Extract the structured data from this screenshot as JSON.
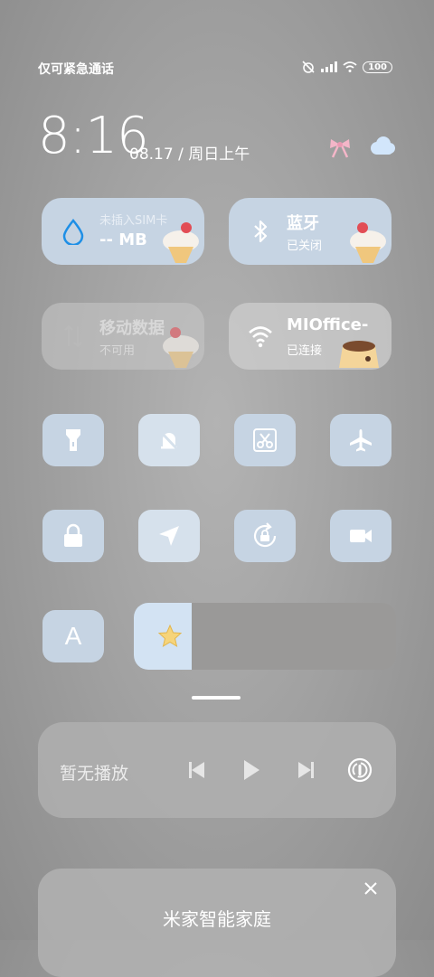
{
  "status_bar": {
    "carrier": "仅可紧急通话",
    "battery": "100"
  },
  "clock": {
    "time": "8:16",
    "date": "08.17 / 周日上午"
  },
  "tiles": [
    {
      "name": "未插入SIM卡",
      "sub": "-- MB",
      "state": "inactive"
    },
    {
      "name": "蓝牙",
      "sub": "已关闭",
      "state": "inactive"
    },
    {
      "name": "移动数据",
      "sub": "不可用",
      "state": "disabled"
    },
    {
      "name": "MIOffice-",
      "sub": "已连接",
      "state": "active"
    }
  ],
  "quick_toggles": [
    "flashlight-icon",
    "silent-icon",
    "screenshot-icon",
    "airplane-icon",
    "lock-icon",
    "location-icon",
    "rotation-lock-icon",
    "video-icon"
  ],
  "reading_mode": {
    "label": "A"
  },
  "brightness": {
    "level": 0.22
  },
  "media": {
    "label": "暂无播放"
  },
  "card": {
    "title": "米家智能家庭",
    "subtitle": ""
  },
  "colors": {
    "tile_blue": "#c6d4e3",
    "accent_blue": "#1e8fe6",
    "brightness_fill": "#d3e3f3"
  }
}
